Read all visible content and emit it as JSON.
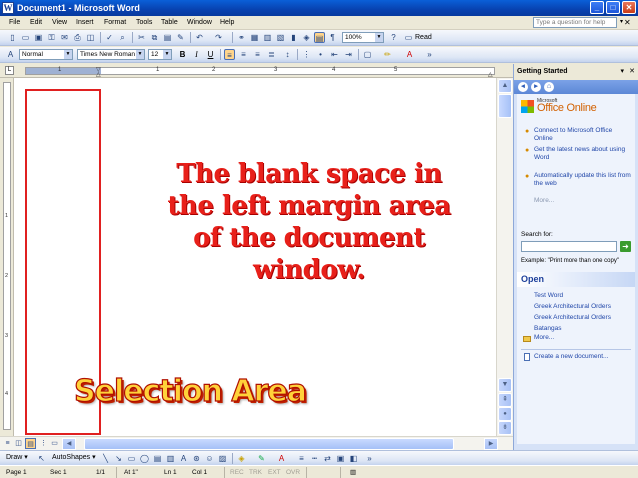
{
  "window": {
    "title": "Document1 - Microsoft Word",
    "app_icon": "word-icon",
    "controls": [
      "minimize",
      "maximize",
      "close"
    ]
  },
  "menu": {
    "items": [
      "File",
      "Edit",
      "View",
      "Insert",
      "Format",
      "Tools",
      "Table",
      "Window",
      "Help"
    ],
    "help_placeholder": "Type a question for help"
  },
  "standard_toolbar": {
    "zoom": "100%",
    "read_label": "Read"
  },
  "formatting_toolbar": {
    "style": "Normal",
    "font": "Times New Roman",
    "size": "12",
    "bold": "B",
    "italic": "I",
    "underline": "U"
  },
  "ruler": {
    "numbers": [
      "1",
      "1",
      "2",
      "3",
      "4",
      "5"
    ]
  },
  "vruler": {
    "numbers": [
      "1",
      "2",
      "3",
      "4"
    ]
  },
  "document": {
    "callout": "The blank space in the left margin area of the document window.",
    "callout_lines": [
      "The blank space in",
      "the left margin area",
      "of the document",
      "window."
    ],
    "label": "Selection Area",
    "highlight_color": "#e02020"
  },
  "task_pane": {
    "title": "Getting Started",
    "logo": "Office Online",
    "logo_small": "Microsoft",
    "links": [
      "Connect to Microsoft Office Online",
      "Get the latest news about using Word",
      "Automatically update this list from the web"
    ],
    "more": "More...",
    "search_label": "Search for:",
    "search_value": "",
    "example": "Example: \"Print more than one copy\"",
    "open_heading": "Open",
    "open_files": [
      "Test Word",
      "Greek Architectural Orders",
      "Greek Architectural Orders",
      "Batangas"
    ],
    "open_more": "More...",
    "create_new": "Create a new document..."
  },
  "drawing_toolbar": {
    "draw": "Draw",
    "autoshapes": "AutoShapes"
  },
  "status_bar": {
    "page": "Page  1",
    "sec": "Sec  1",
    "pages": "1/1",
    "at": "At  1\"",
    "ln": "Ln  1",
    "col": "Col  1",
    "modes": [
      "REC",
      "TRK",
      "EXT",
      "OVR"
    ]
  }
}
